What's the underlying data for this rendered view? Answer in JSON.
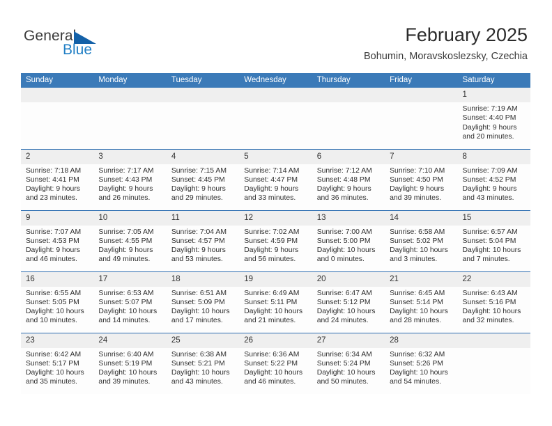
{
  "brand": {
    "name_part1": "General",
    "name_part2": "Blue",
    "logo_icon": "triangle-icon",
    "accent_color": "#1f7ec4"
  },
  "header": {
    "title": "February 2025",
    "subtitle": "Bohumin, Moravskoslezsky, Czechia"
  },
  "colors": {
    "header_blue": "#3b7ab8",
    "row_divider": "#2a6cb0",
    "daynum_band": "#efefef"
  },
  "calendar": {
    "weekdays": [
      "Sunday",
      "Monday",
      "Tuesday",
      "Wednesday",
      "Thursday",
      "Friday",
      "Saturday"
    ],
    "weeks": [
      [
        {
          "day": "",
          "lines": []
        },
        {
          "day": "",
          "lines": []
        },
        {
          "day": "",
          "lines": []
        },
        {
          "day": "",
          "lines": []
        },
        {
          "day": "",
          "lines": []
        },
        {
          "day": "",
          "lines": []
        },
        {
          "day": "1",
          "lines": [
            "Sunrise: 7:19 AM",
            "Sunset: 4:40 PM",
            "Daylight: 9 hours",
            "and 20 minutes."
          ]
        }
      ],
      [
        {
          "day": "2",
          "lines": [
            "Sunrise: 7:18 AM",
            "Sunset: 4:41 PM",
            "Daylight: 9 hours",
            "and 23 minutes."
          ]
        },
        {
          "day": "3",
          "lines": [
            "Sunrise: 7:17 AM",
            "Sunset: 4:43 PM",
            "Daylight: 9 hours",
            "and 26 minutes."
          ]
        },
        {
          "day": "4",
          "lines": [
            "Sunrise: 7:15 AM",
            "Sunset: 4:45 PM",
            "Daylight: 9 hours",
            "and 29 minutes."
          ]
        },
        {
          "day": "5",
          "lines": [
            "Sunrise: 7:14 AM",
            "Sunset: 4:47 PM",
            "Daylight: 9 hours",
            "and 33 minutes."
          ]
        },
        {
          "day": "6",
          "lines": [
            "Sunrise: 7:12 AM",
            "Sunset: 4:48 PM",
            "Daylight: 9 hours",
            "and 36 minutes."
          ]
        },
        {
          "day": "7",
          "lines": [
            "Sunrise: 7:10 AM",
            "Sunset: 4:50 PM",
            "Daylight: 9 hours",
            "and 39 minutes."
          ]
        },
        {
          "day": "8",
          "lines": [
            "Sunrise: 7:09 AM",
            "Sunset: 4:52 PM",
            "Daylight: 9 hours",
            "and 43 minutes."
          ]
        }
      ],
      [
        {
          "day": "9",
          "lines": [
            "Sunrise: 7:07 AM",
            "Sunset: 4:53 PM",
            "Daylight: 9 hours",
            "and 46 minutes."
          ]
        },
        {
          "day": "10",
          "lines": [
            "Sunrise: 7:05 AM",
            "Sunset: 4:55 PM",
            "Daylight: 9 hours",
            "and 49 minutes."
          ]
        },
        {
          "day": "11",
          "lines": [
            "Sunrise: 7:04 AM",
            "Sunset: 4:57 PM",
            "Daylight: 9 hours",
            "and 53 minutes."
          ]
        },
        {
          "day": "12",
          "lines": [
            "Sunrise: 7:02 AM",
            "Sunset: 4:59 PM",
            "Daylight: 9 hours",
            "and 56 minutes."
          ]
        },
        {
          "day": "13",
          "lines": [
            "Sunrise: 7:00 AM",
            "Sunset: 5:00 PM",
            "Daylight: 10 hours",
            "and 0 minutes."
          ]
        },
        {
          "day": "14",
          "lines": [
            "Sunrise: 6:58 AM",
            "Sunset: 5:02 PM",
            "Daylight: 10 hours",
            "and 3 minutes."
          ]
        },
        {
          "day": "15",
          "lines": [
            "Sunrise: 6:57 AM",
            "Sunset: 5:04 PM",
            "Daylight: 10 hours",
            "and 7 minutes."
          ]
        }
      ],
      [
        {
          "day": "16",
          "lines": [
            "Sunrise: 6:55 AM",
            "Sunset: 5:05 PM",
            "Daylight: 10 hours",
            "and 10 minutes."
          ]
        },
        {
          "day": "17",
          "lines": [
            "Sunrise: 6:53 AM",
            "Sunset: 5:07 PM",
            "Daylight: 10 hours",
            "and 14 minutes."
          ]
        },
        {
          "day": "18",
          "lines": [
            "Sunrise: 6:51 AM",
            "Sunset: 5:09 PM",
            "Daylight: 10 hours",
            "and 17 minutes."
          ]
        },
        {
          "day": "19",
          "lines": [
            "Sunrise: 6:49 AM",
            "Sunset: 5:11 PM",
            "Daylight: 10 hours",
            "and 21 minutes."
          ]
        },
        {
          "day": "20",
          "lines": [
            "Sunrise: 6:47 AM",
            "Sunset: 5:12 PM",
            "Daylight: 10 hours",
            "and 24 minutes."
          ]
        },
        {
          "day": "21",
          "lines": [
            "Sunrise: 6:45 AM",
            "Sunset: 5:14 PM",
            "Daylight: 10 hours",
            "and 28 minutes."
          ]
        },
        {
          "day": "22",
          "lines": [
            "Sunrise: 6:43 AM",
            "Sunset: 5:16 PM",
            "Daylight: 10 hours",
            "and 32 minutes."
          ]
        }
      ],
      [
        {
          "day": "23",
          "lines": [
            "Sunrise: 6:42 AM",
            "Sunset: 5:17 PM",
            "Daylight: 10 hours",
            "and 35 minutes."
          ]
        },
        {
          "day": "24",
          "lines": [
            "Sunrise: 6:40 AM",
            "Sunset: 5:19 PM",
            "Daylight: 10 hours",
            "and 39 minutes."
          ]
        },
        {
          "day": "25",
          "lines": [
            "Sunrise: 6:38 AM",
            "Sunset: 5:21 PM",
            "Daylight: 10 hours",
            "and 43 minutes."
          ]
        },
        {
          "day": "26",
          "lines": [
            "Sunrise: 6:36 AM",
            "Sunset: 5:22 PM",
            "Daylight: 10 hours",
            "and 46 minutes."
          ]
        },
        {
          "day": "27",
          "lines": [
            "Sunrise: 6:34 AM",
            "Sunset: 5:24 PM",
            "Daylight: 10 hours",
            "and 50 minutes."
          ]
        },
        {
          "day": "28",
          "lines": [
            "Sunrise: 6:32 AM",
            "Sunset: 5:26 PM",
            "Daylight: 10 hours",
            "and 54 minutes."
          ]
        },
        {
          "day": "",
          "lines": []
        }
      ]
    ]
  }
}
